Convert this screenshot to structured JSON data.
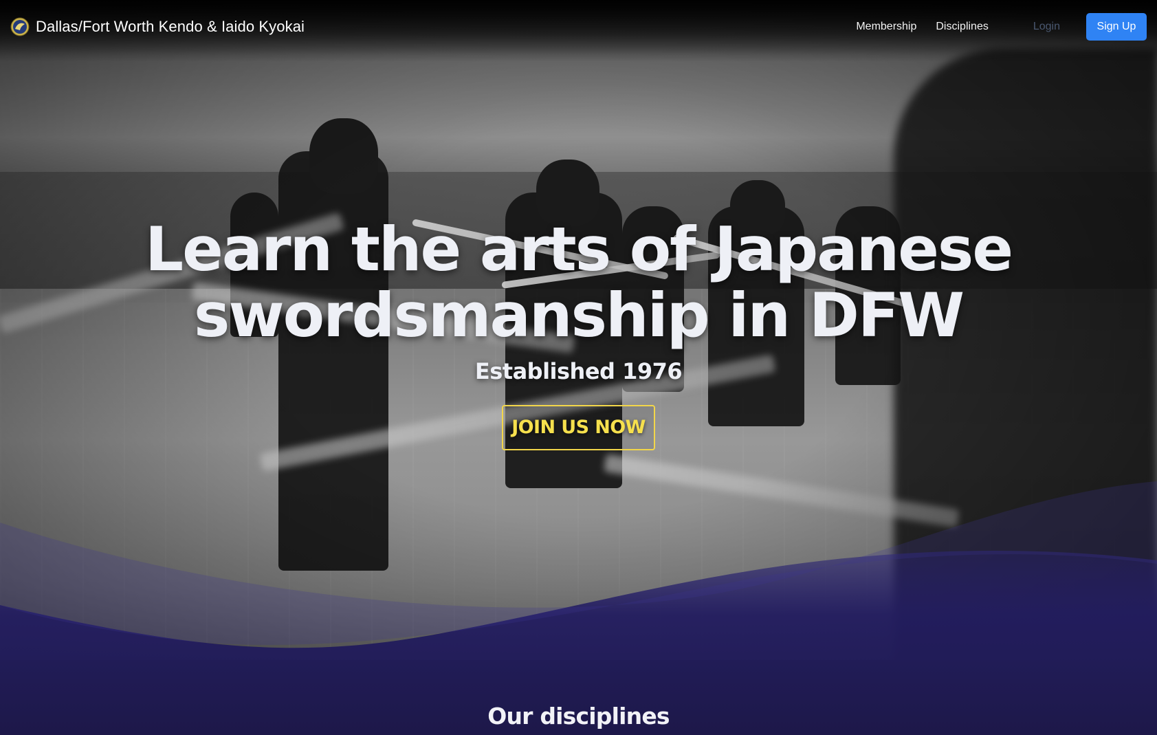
{
  "navbar": {
    "brand_name": "Dallas/Fort Worth Kendo & Iaido Kyokai",
    "links": {
      "membership": "Membership",
      "disciplines": "Disciplines"
    },
    "login_label": "Login",
    "signup_label": "Sign Up"
  },
  "hero": {
    "title": "Learn the arts of Japanese swordsmanship in DFW",
    "subtitle": "Established 1976",
    "cta_label": "JOIN US NOW"
  },
  "disciplines_section": {
    "title": "Our disciplines"
  },
  "colors": {
    "signup_button": "#2f83f4",
    "cta_accent": "#f2d64a",
    "section_background": "#1e1a4f",
    "login_link": "#4a5870"
  },
  "icons": {
    "brand_logo": "club-crest-icon"
  }
}
